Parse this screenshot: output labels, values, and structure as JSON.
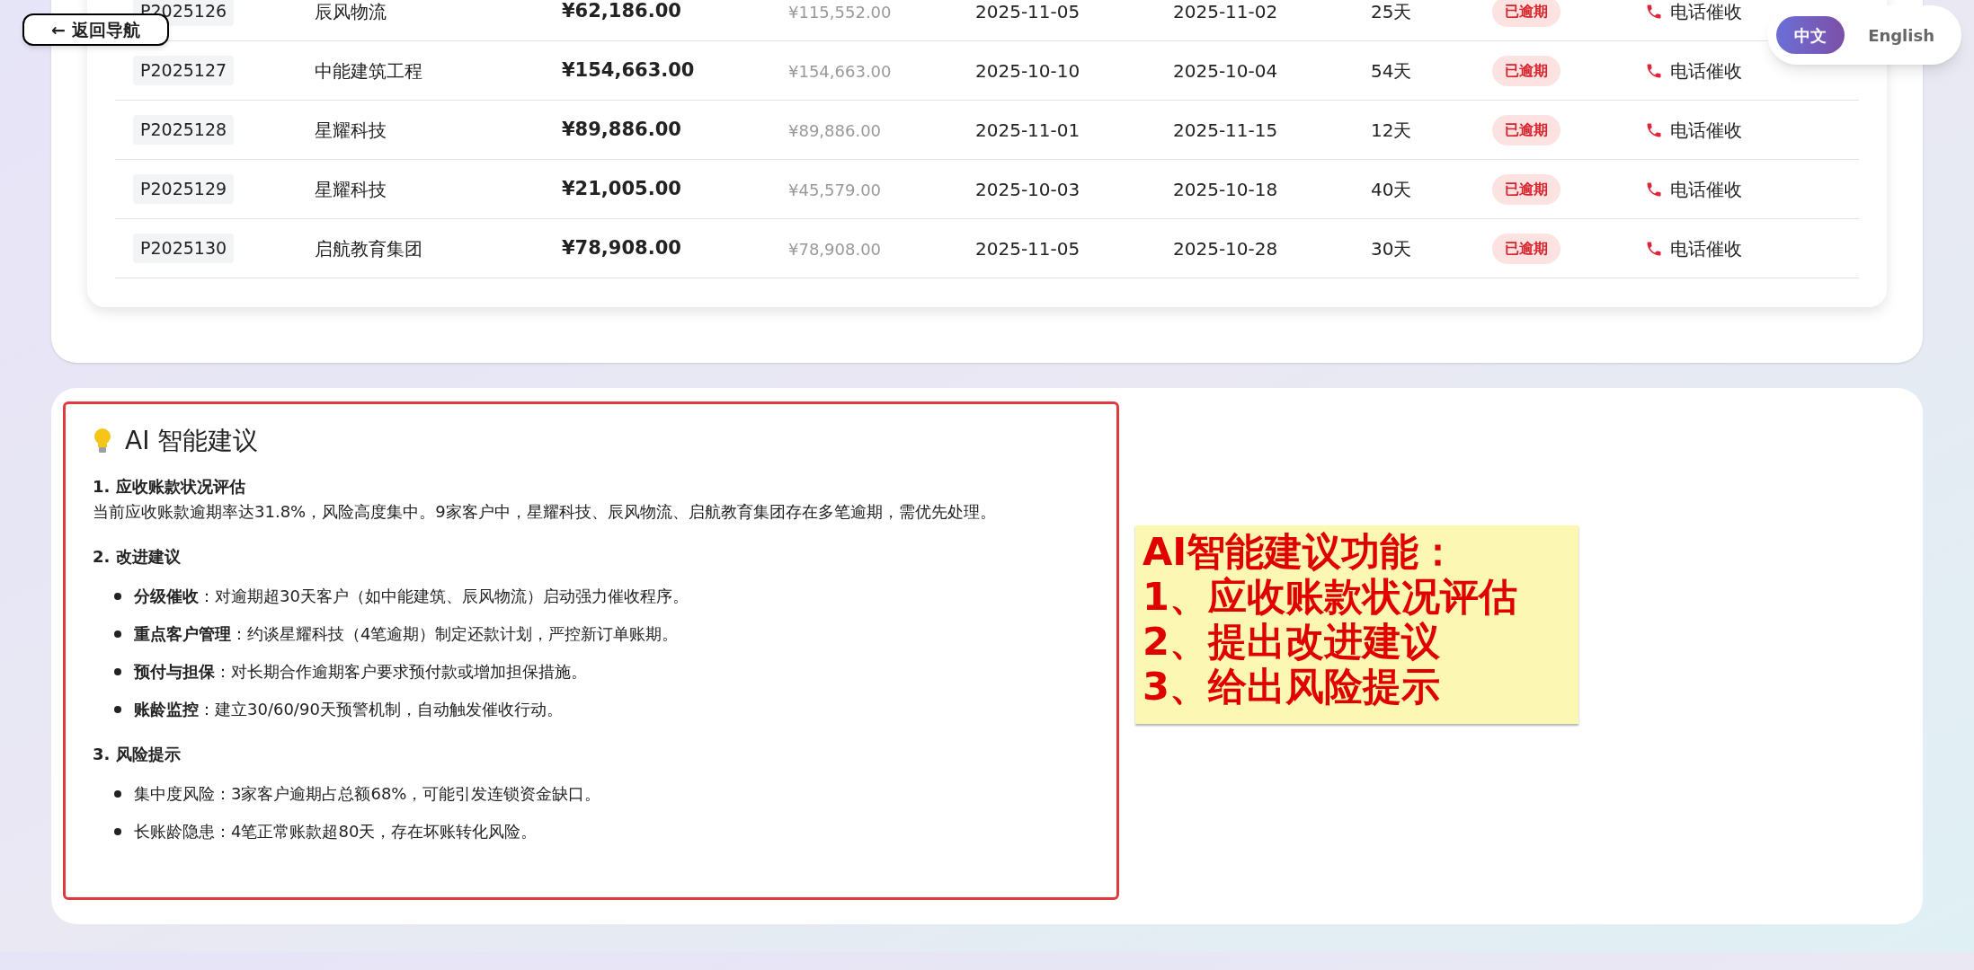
{
  "back_button": {
    "label": "← 返回导航"
  },
  "language_toggle": [
    {
      "label": "中文",
      "selected": true
    },
    {
      "label": "English",
      "selected": false
    }
  ],
  "table": {
    "rows": [
      {
        "code": "P2025126",
        "customer": "辰风物流",
        "amount": "¥62,186.00",
        "original_amount": "¥115,552.00",
        "date_1": "2025-11-05",
        "date_2": "2025-11-02",
        "days": "25天",
        "status": "已逾期",
        "action": "电话催收"
      },
      {
        "code": "P2025127",
        "customer": "中能建筑工程",
        "amount": "¥154,663.00",
        "original_amount": "¥154,663.00",
        "date_1": "2025-10-10",
        "date_2": "2025-10-04",
        "days": "54天",
        "status": "已逾期",
        "action": "电话催收"
      },
      {
        "code": "P2025128",
        "customer": "星耀科技",
        "amount": "¥89,886.00",
        "original_amount": "¥89,886.00",
        "date_1": "2025-11-01",
        "date_2": "2025-11-15",
        "days": "12天",
        "status": "已逾期",
        "action": "电话催收"
      },
      {
        "code": "P2025129",
        "customer": "星耀科技",
        "amount": "¥21,005.00",
        "original_amount": "¥45,579.00",
        "date_1": "2025-10-03",
        "date_2": "2025-10-18",
        "days": "40天",
        "status": "已逾期",
        "action": "电话催收"
      },
      {
        "code": "P2025130",
        "customer": "启航教育集团",
        "amount": "¥78,908.00",
        "original_amount": "¥78,908.00",
        "date_1": "2025-11-05",
        "date_2": "2025-10-28",
        "days": "30天",
        "status": "已逾期",
        "action": "电话催收"
      }
    ]
  },
  "ai_panel": {
    "title": "AI 智能建议",
    "sections": [
      {
        "heading": "1. 应收账款状况评估",
        "paragraph": "当前应收账款逾期率达31.8%，风险高度集中。9家客户中，星耀科技、辰风物流、启航教育集团存在多笔逾期，需优先处理。"
      },
      {
        "heading": "2. 改进建议",
        "bullets": [
          "**分级催收**：对逾期超30天客户（如中能建筑、辰风物流）启动强力催收程序。",
          "**重点客户管理**：约谈星耀科技（4笔逾期）制定还款计划，严控新订单账期。",
          "**预付与担保**：对长期合作逾期客户要求预付款或增加担保措施。",
          "**账龄监控**：建立30/60/90天预警机制，自动触发催收行动。"
        ]
      },
      {
        "heading": "3. 风险提示",
        "bullets": [
          "集中度风险：3家客户逾期占总额68%，可能引发连锁资金缺口。",
          "长账龄隐患：4笔正常账款超80天，存在坏账转化风险。"
        ]
      }
    ]
  },
  "annotation": {
    "lines": [
      "AI智能建议功能：",
      "1、应收账款状况评估",
      "2、提出改进建议",
      "3、给出风险提示"
    ]
  }
}
